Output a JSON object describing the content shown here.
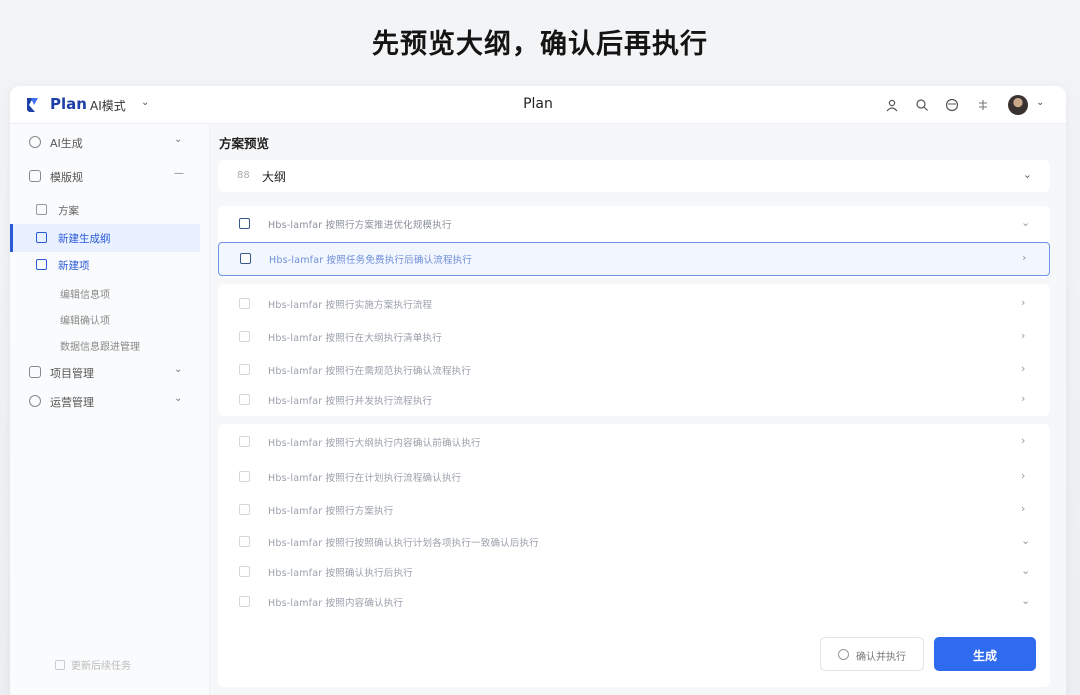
{
  "headline": "先预览大纲，确认后再执行",
  "topbar": {
    "brand": "Plan",
    "mode": "AI模式",
    "title": "Plan",
    "icons": [
      "user-icon",
      "search-icon",
      "smile-icon",
      "settings-icon"
    ]
  },
  "sidebar": {
    "items": [
      {
        "label": "AI生成",
        "icon": "ai-icon",
        "expanded": false
      },
      {
        "label": "模版规",
        "icon": "template-icon",
        "expanded": true
      }
    ],
    "sub_items": [
      {
        "label": "方案",
        "icon": "doc-icon"
      },
      {
        "label": "新建生成纲",
        "icon": "create-icon",
        "active": true
      },
      {
        "label": "新建项",
        "icon": "item-icon",
        "blue": true
      }
    ],
    "deep_items": [
      "编辑信息项",
      "编辑确认项",
      "数据信息跟进管理"
    ],
    "bottom_items": [
      {
        "label": "项目管理",
        "icon": "project-icon"
      },
      {
        "label": "运营管理",
        "icon": "ops-icon"
      }
    ],
    "footer": "更新后续任务"
  },
  "main": {
    "section_title": "方案预览",
    "outline_label": "大纲",
    "outline_icon_text": "88",
    "group1": [
      "Hbs-lamfar 按照行方案推进优化规模执行",
      "Hbs-lamfar 按照任务免费执行后确认流程执行"
    ],
    "group2": [
      "Hbs-lamfar 按照行实施方案执行流程",
      "Hbs-lamfar 按照行在大纲执行清单执行",
      "Hbs-lamfar 按照行在需规范执行确认流程执行",
      "Hbs-lamfar 按照行并发执行流程执行"
    ],
    "group3": [
      "Hbs-lamfar 按照行大纲执行内容确认前确认执行",
      "Hbs-lamfar 按照行在计划执行流程确认执行",
      "Hbs-lamfar 按照行方案执行",
      "Hbs-lamfar 按照行按照确认执行计划各项执行一致确认后执行",
      "Hbs-lamfar 按照确认执行后执行",
      "Hbs-lamfar 按照内容确认执行"
    ],
    "confirm_button": "确认并执行",
    "generate_button": "生成"
  },
  "colors": {
    "accent": "#2e6bef",
    "brand": "#1f3fa8",
    "selected_border": "#6f93e6"
  }
}
